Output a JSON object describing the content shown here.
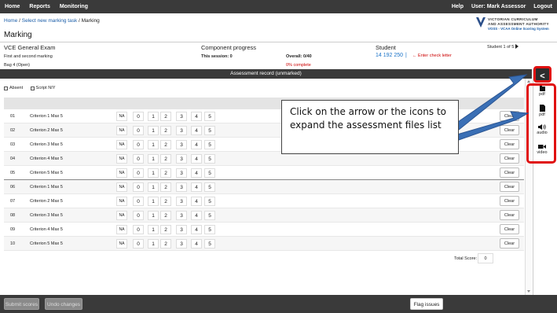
{
  "topnav": {
    "items": [
      "Home",
      "Reports",
      "Monitoring"
    ],
    "help": "Help",
    "user": "User: Mark Assessor",
    "logout": "Logout"
  },
  "breadcrumb": {
    "home": "Home",
    "sep1": " / ",
    "select": "Select new marking task",
    "sep2": " / ",
    "current": "Marking"
  },
  "logo": {
    "line1": "VICTORIAN CURRICULUM",
    "line2": "AND ASSESSMENT AUTHORITY",
    "line3": "VOSS - VCAA Online Scoring System"
  },
  "page_title": "Marking",
  "exam": {
    "title": "VCE General Exam",
    "subtitle": "First and second marking",
    "bag": "Bag 4   (Open)"
  },
  "progress": {
    "title": "Component progress",
    "session": "This session: 0",
    "overall": "Overall: 0/40",
    "complete": "0% complete"
  },
  "student": {
    "title": "Student",
    "id": "14 192 250",
    "bar": "|",
    "check": "← Enter check letter",
    "of": "Student 1 of 5"
  },
  "banner": "Assessment record (unmarked)",
  "checks": {
    "absent": "Absent",
    "script_niy": "Script NIY"
  },
  "options": [
    "NA",
    "0",
    "1",
    "2",
    "3",
    "4",
    "5"
  ],
  "clear_label": "Clear",
  "rows": [
    {
      "num": "01",
      "criterion": "Criterion 1 Max 5"
    },
    {
      "num": "02",
      "criterion": "Criterion 2 Max 5"
    },
    {
      "num": "03",
      "criterion": "Criterion 3 Max 5"
    },
    {
      "num": "04",
      "criterion": "Criterion 4 Max 5"
    },
    {
      "num": "05",
      "criterion": "Criterion 5 Max 5"
    },
    {
      "num": "06",
      "criterion": "Criterion 1 Max 5"
    },
    {
      "num": "07",
      "criterion": "Criterion 2 Max 5"
    },
    {
      "num": "08",
      "criterion": "Criterion 3 Max 5"
    },
    {
      "num": "09",
      "criterion": "Criterion 4 Max 5"
    },
    {
      "num": "10",
      "criterion": "Criterion 5 Max 5"
    }
  ],
  "total": {
    "label": "Total Score:",
    "value": "0"
  },
  "footer": {
    "submit": "Submit scores",
    "undo": "Undo changes",
    "flag": "Flag issues"
  },
  "side": {
    "toggle": "<",
    "files": [
      "pdf",
      "pdf",
      "audio",
      "video"
    ]
  },
  "callout": "Click on the arrow or the icons to expand the assessment files list",
  "colors": {
    "highlight": "#e01010",
    "arrow": "#3a6fb5",
    "link": "#1a5da8",
    "bar": "#3a3a3a"
  }
}
